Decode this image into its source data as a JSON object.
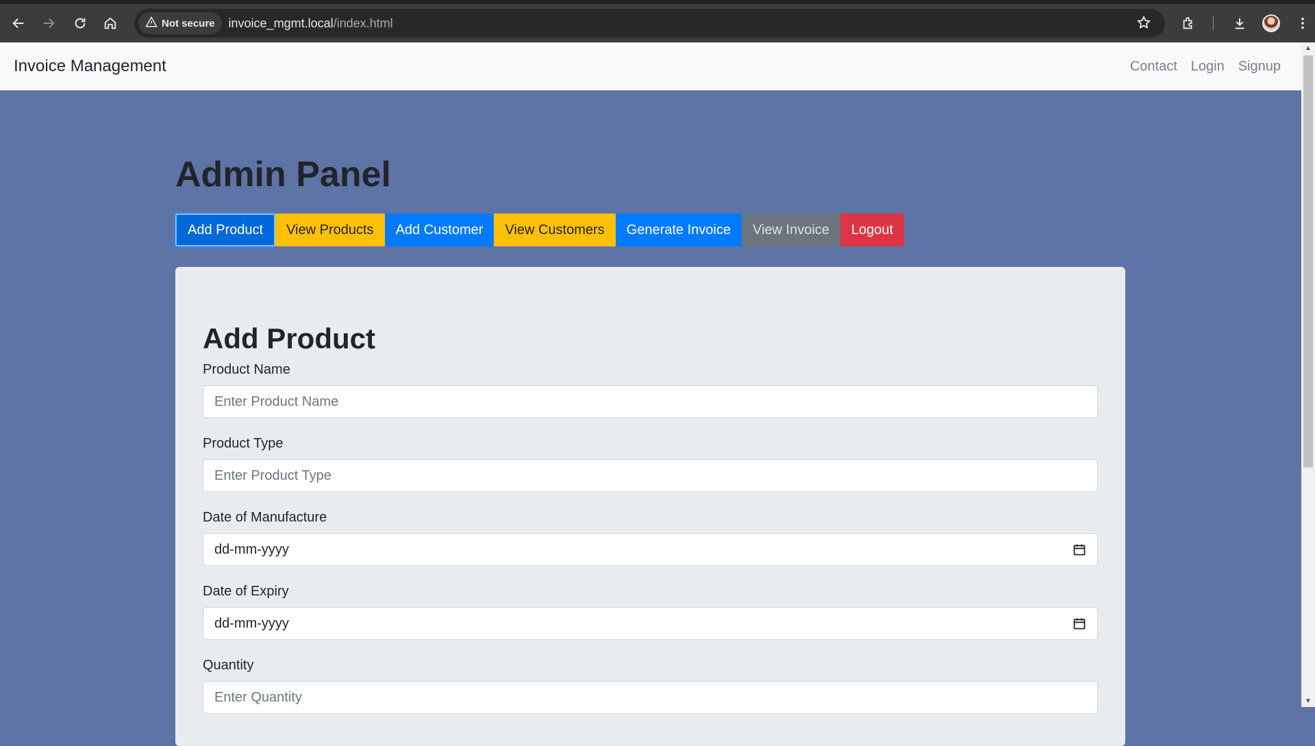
{
  "browser": {
    "security_label": "Not secure",
    "url_host": "invoice_mgmt.local",
    "url_path": "/index.html"
  },
  "navbar": {
    "brand": "Invoice Management",
    "links": [
      "Contact",
      "Login",
      "Signup"
    ]
  },
  "page": {
    "title": "Admin Panel",
    "buttons": [
      {
        "label": "Add Product",
        "style": "primary-active"
      },
      {
        "label": "View Products",
        "style": "warning"
      },
      {
        "label": "Add Customer",
        "style": "primary"
      },
      {
        "label": "View Customers",
        "style": "warning"
      },
      {
        "label": "Generate Invoice",
        "style": "primary"
      },
      {
        "label": "View Invoice",
        "style": "secondary"
      },
      {
        "label": "Logout",
        "style": "danger"
      }
    ]
  },
  "form": {
    "title": "Add Product",
    "fields": {
      "product_name": {
        "label": "Product Name",
        "placeholder": "Enter Product Name"
      },
      "product_type": {
        "label": "Product Type",
        "placeholder": "Enter Product Type"
      },
      "manufacture_date": {
        "label": "Date of Manufacture",
        "placeholder": "dd-mm-yyyy"
      },
      "expiry_date": {
        "label": "Date of Expiry",
        "placeholder": "dd-mm-yyyy"
      },
      "quantity": {
        "label": "Quantity",
        "placeholder": "Enter Quantity"
      }
    }
  },
  "colors": {
    "page_background": "#5e73a6",
    "primary": "#007bff",
    "warning": "#ffc107",
    "secondary": "#6c757d",
    "danger": "#dc3545",
    "card_background": "#e9ecef"
  }
}
